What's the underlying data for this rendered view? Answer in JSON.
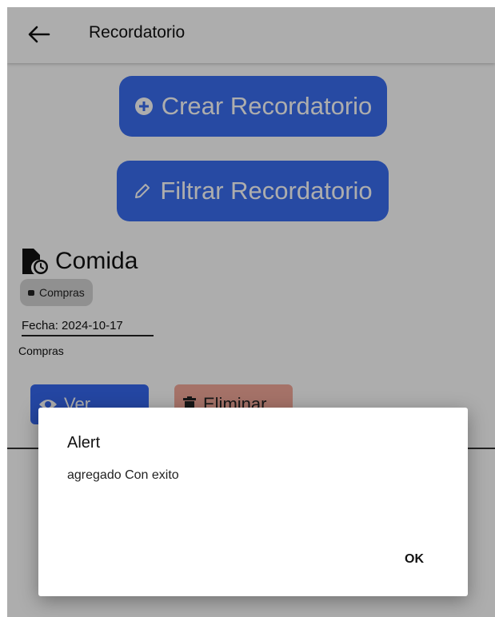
{
  "appbar": {
    "title": "Recordatorio"
  },
  "actions": {
    "create_label": "Crear Recordatorio",
    "filter_label": "Filtrar Recordatorio"
  },
  "reminder": {
    "title": "Comida",
    "category": "Compras",
    "date_text": "Fecha: 2024-10-17",
    "description": "Compras",
    "view_label": "Ver",
    "delete_label": "Eliminar"
  },
  "alert": {
    "title": "Alert",
    "message": "agregado Con exito",
    "ok_label": "OK"
  },
  "colors": {
    "primary": "#3a6df0",
    "danger": "#f4a89a",
    "chip": "#d4d4d4"
  }
}
